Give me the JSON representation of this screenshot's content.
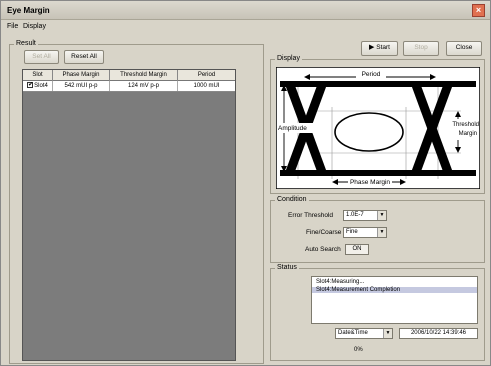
{
  "window": {
    "title": "Eye Margin"
  },
  "menu": [
    "File",
    "Display"
  ],
  "result": {
    "group_label": "Result",
    "set_all_label": "Set All",
    "reset_all_label": "Reset All",
    "columns": [
      "Slot",
      "Phase Margin",
      "Threshold Margin",
      "Period"
    ],
    "rows": [
      {
        "checked": "✔",
        "slot": "Slot4",
        "phase_margin": "542 mUI p-p",
        "threshold_margin": "124 mV p-p",
        "period": "1000 mUI"
      }
    ]
  },
  "toolbar": {
    "start_label": "Start",
    "stop_label": "Stop",
    "close_label": "Close"
  },
  "display": {
    "group_label": "Display",
    "period_label": "Period",
    "amplitude_label": "Amplitude",
    "threshold_label_1": "Threshold",
    "threshold_label_2": "Margin",
    "phase_margin_label": "Phase Margin"
  },
  "condition": {
    "group_label": "Condition",
    "error_threshold_label": "Error Threshold",
    "error_threshold_value": "1.0E-7",
    "fine_coarse_label": "Fine/Coarse",
    "fine_coarse_value": "Fine",
    "auto_search_label": "Auto Search",
    "auto_search_value": "ON"
  },
  "status": {
    "group_label": "Status",
    "messages": [
      "Slot4:Measuring...",
      "Slot4:Measurement Completion"
    ],
    "time_mode": "Date&Time",
    "timestamp": "2006/10/22 14:39:46",
    "progress_text": "0%",
    "progress": 0
  }
}
